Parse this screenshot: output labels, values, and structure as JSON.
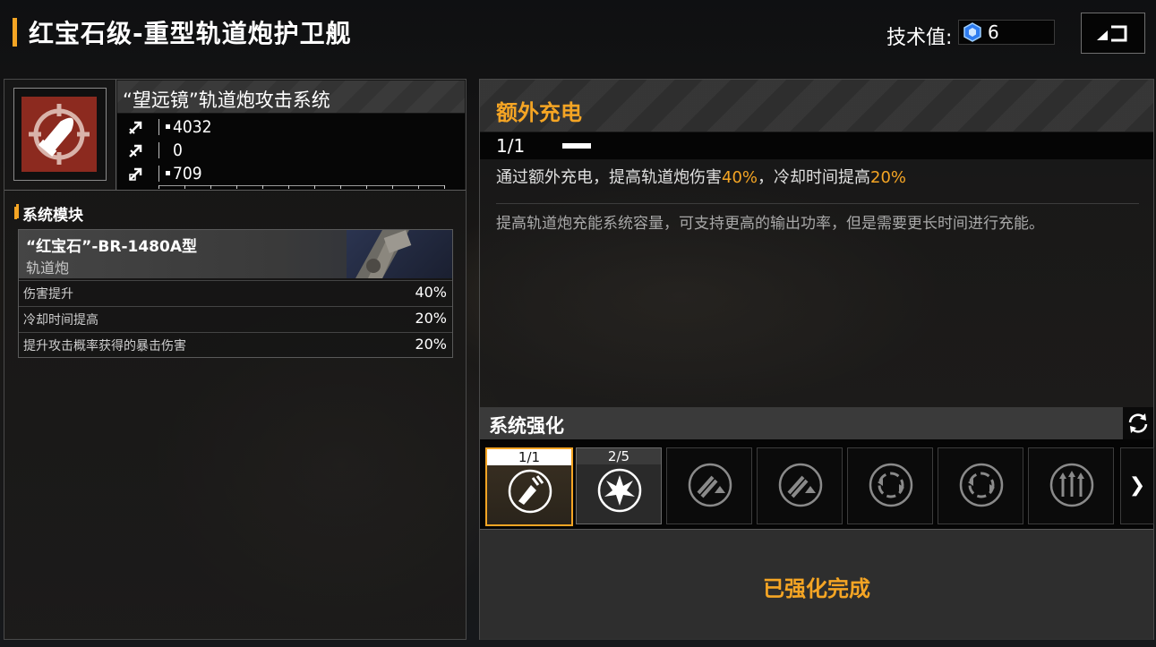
{
  "header": {
    "title": "红宝石级-重型轨道炮护卫舰",
    "tech_label": "技术值:",
    "tech_value": "6",
    "accent_color": "#f5a524",
    "back_icon": "back-arrow-icon"
  },
  "weapon": {
    "title": "“望远镜”轨道炮攻击系统",
    "icon": "railgun-shell-icon",
    "stats": [
      {
        "icon": "damage-arrow-icon",
        "value": "4032"
      },
      {
        "icon": "penetration-arrow-icon",
        "value": "0"
      },
      {
        "icon": "siege-arrow-icon",
        "value": "709"
      }
    ]
  },
  "modules": {
    "header": "系统模块",
    "card": {
      "name": "“红宝石”-BR-1480A型",
      "type": "轨道炮",
      "attributes": [
        {
          "label": "伤害提升",
          "value": "40%"
        },
        {
          "label": "冷却时间提高",
          "value": "20%"
        },
        {
          "label": "提升攻击概率获得的暴击伤害",
          "value": "20%"
        }
      ]
    }
  },
  "upgrade": {
    "name": "额外充电",
    "level": "1/1",
    "effect": {
      "p1": "通过额外充电，提高轨道炮伤害",
      "v1": "40%",
      "p2": "，冷却时间提高",
      "v2": "20%"
    },
    "description": "提高轨道炮充能系统容量，可支持更高的输出功率，但是需要更长时间进行充能。"
  },
  "enhancement": {
    "title": "系统强化",
    "slots": [
      {
        "level": "1/1",
        "icon": "extra-charge-icon",
        "state": "selected"
      },
      {
        "level": "2/5",
        "icon": "burst-icon",
        "state": "upgraded"
      },
      {
        "level": "",
        "icon": "damage-up-icon",
        "state": "locked"
      },
      {
        "level": "",
        "icon": "damage-up-icon",
        "state": "locked"
      },
      {
        "level": "",
        "icon": "cooldown-cycle-icon",
        "state": "locked"
      },
      {
        "level": "",
        "icon": "cooldown-cycle-icon",
        "state": "locked"
      },
      {
        "level": "",
        "icon": "triple-arrow-up-icon",
        "state": "locked"
      }
    ],
    "next_label": "❯",
    "status": "已强化完成"
  }
}
